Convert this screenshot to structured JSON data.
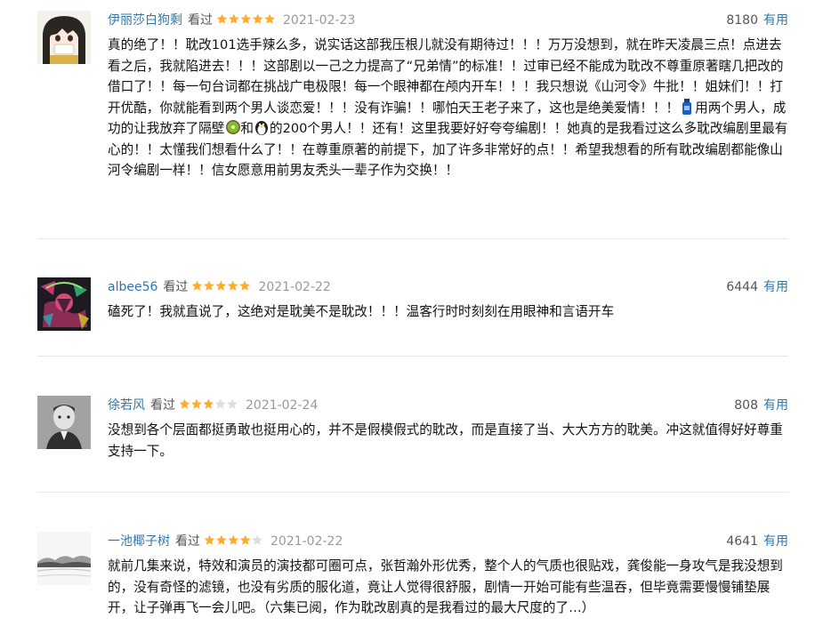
{
  "reviews": [
    {
      "username": "伊丽莎白狗剩",
      "watched": "看过",
      "rating": 5,
      "date": "2021-02-23",
      "votes": "8180",
      "useful_label": "有用",
      "avatar_icon": "anime-girl-avatar",
      "text_part1": "真的绝了！！耽改101选手辣么多，说实话这部我压根儿就没有期待过！！！万万没想到，就在昨天凌晨三点！点进去看之后，我就陷进去！！！这部剧以一己之力提高了“兄弟情”的标准！！过审已经不能成为耽改不尊重原著瞎几把改的借口了！！每一句台词都在挑战广电极限！每一个眼神都在颅内开车！！！我只想说《山河令》牛批！！姐妹们！！打开优酷，你就能看到两个男人谈恋爱！！！没有诈骗！！哪怕天王老子来了，这也是绝美爱情！！！",
      "text_part2": "用两个男人，成功的让我放弃了隔壁",
      "text_part3": "和",
      "text_part4": "的200个男人！！还有！这里我要好好夸夸编剧！！她真的是我看过这么多耽改编剧里最有心的！！太懂我们想看什么了！！在尊重原著的前提下，加了许多非常好的点！！希望我想看的所有耽改编剧都能像山河令编剧一样！！信女愿意用前男友秃头一辈子作为交换！！",
      "emojis": [
        "bottle-emoji",
        "kiwi-emoji",
        "penguin-emoji"
      ]
    },
    {
      "username": "albee56",
      "watched": "看过",
      "rating": 5,
      "date": "2021-02-22",
      "votes": "6444",
      "useful_label": "有用",
      "avatar_icon": "colorful-art-avatar",
      "text": "磕死了！我就直说了，这绝对是耽美不是耽改！！！温客行时时刻刻在用眼神和言语开车"
    },
    {
      "username": "徐若风",
      "watched": "看过",
      "rating": 3,
      "date": "2021-02-24",
      "votes": "808",
      "useful_label": "有用",
      "avatar_icon": "vintage-boy-photo-avatar",
      "text": "没想到各个层面都挺勇敢也挺用心的，并不是假模假式的耽改，而是直接了当、大大方方的耽美。冲这就值得好好尊重支持一下。"
    },
    {
      "username": "一池椰子树",
      "watched": "看过",
      "rating": 4,
      "date": "2021-02-22",
      "votes": "4641",
      "useful_label": "有用",
      "avatar_icon": "ink-landscape-avatar",
      "text": "就前几集来说，特效和演员的演技都可圈可点，张哲瀚外形优秀，整个人的气质也很贴戏，龚俊能一身攻气是我没想到的，没有奇怪的滤镜，也没有劣质的服化道，竟让人觉得很舒服，剧情一开始可能有些温吞，但毕竟需要慢慢铺垫展开，让子弹再飞一会儿吧。（六集已阅，作为耽改剧真的是我看过的最大尺度的了…）"
    }
  ],
  "colors": {
    "link": "#3377aa",
    "star": "#ffac2d",
    "star_empty": "#dddddd",
    "date": "#999999",
    "divider": "#e6e6e6"
  }
}
